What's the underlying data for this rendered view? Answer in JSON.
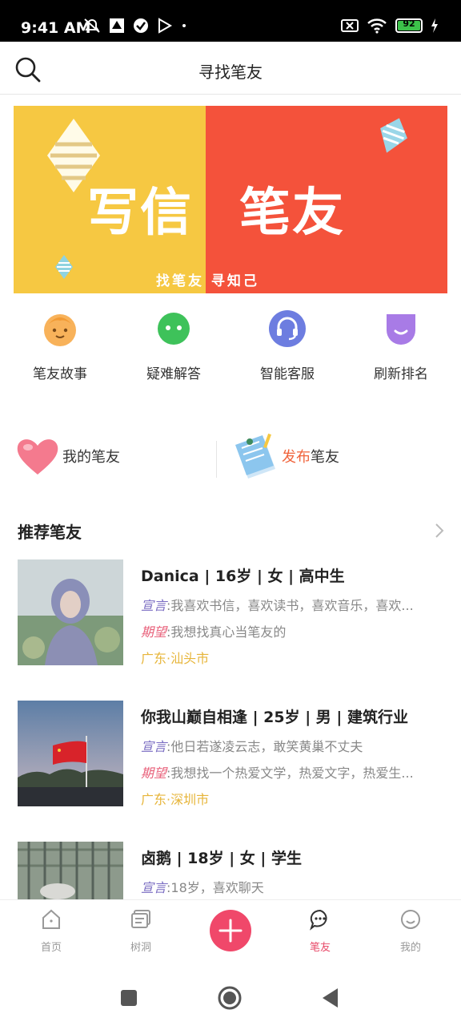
{
  "status_bar": {
    "time": "9:41 AM",
    "battery": "92"
  },
  "header": {
    "title": "寻找笔友"
  },
  "banner": {
    "left_text": "写信",
    "right_text": "笔友",
    "subtitle": "找笔友 寻知己"
  },
  "menu": {
    "items": [
      {
        "label": "笔友故事",
        "icon": "child-face-icon"
      },
      {
        "label": "疑难解答",
        "icon": "chat-bubble-icon"
      },
      {
        "label": "智能客服",
        "icon": "headset-icon"
      },
      {
        "label": "刷新排名",
        "icon": "shield-smile-icon"
      }
    ]
  },
  "pals": {
    "mine": "我的笔友",
    "publish_accent": "发布",
    "publish_rest": "笔友"
  },
  "section": {
    "title": "推荐笔友"
  },
  "cards": [
    {
      "title": "Danica | 16岁 | 女 | 高中生",
      "decl_tag": "宣言",
      "decl": ":我喜欢书信，喜欢读书，喜欢音乐，喜欢...",
      "hope_tag": "期望",
      "hope": ":我想找真心当笔友的",
      "location": "广东·汕头市"
    },
    {
      "title": "你我山巅自相逢 | 25岁 | 男 | 建筑行业",
      "decl_tag": "宣言",
      "decl": ":他日若遂凌云志，敢笑黄巢不丈夫",
      "hope_tag": "期望",
      "hope": ":我想找一个热爱文学，热爱文字，热爱生...",
      "location": "广东·深圳市"
    },
    {
      "title": "卤鹅 | 18岁 | 女 | 学生",
      "decl_tag": "宣言",
      "decl": ":18岁，喜欢聊天"
    }
  ],
  "tabs": [
    {
      "label": "首页",
      "icon": "home-icon"
    },
    {
      "label": "树洞",
      "icon": "message-board-icon"
    },
    {
      "label": "笔友",
      "icon": "chat-dots-icon"
    },
    {
      "label": "我的",
      "icon": "smile-face-icon"
    }
  ],
  "colors": {
    "accent": "#f0486a",
    "banner_left": "#f6c842",
    "banner_right": "#f4523b",
    "location": "#e7b53a"
  }
}
